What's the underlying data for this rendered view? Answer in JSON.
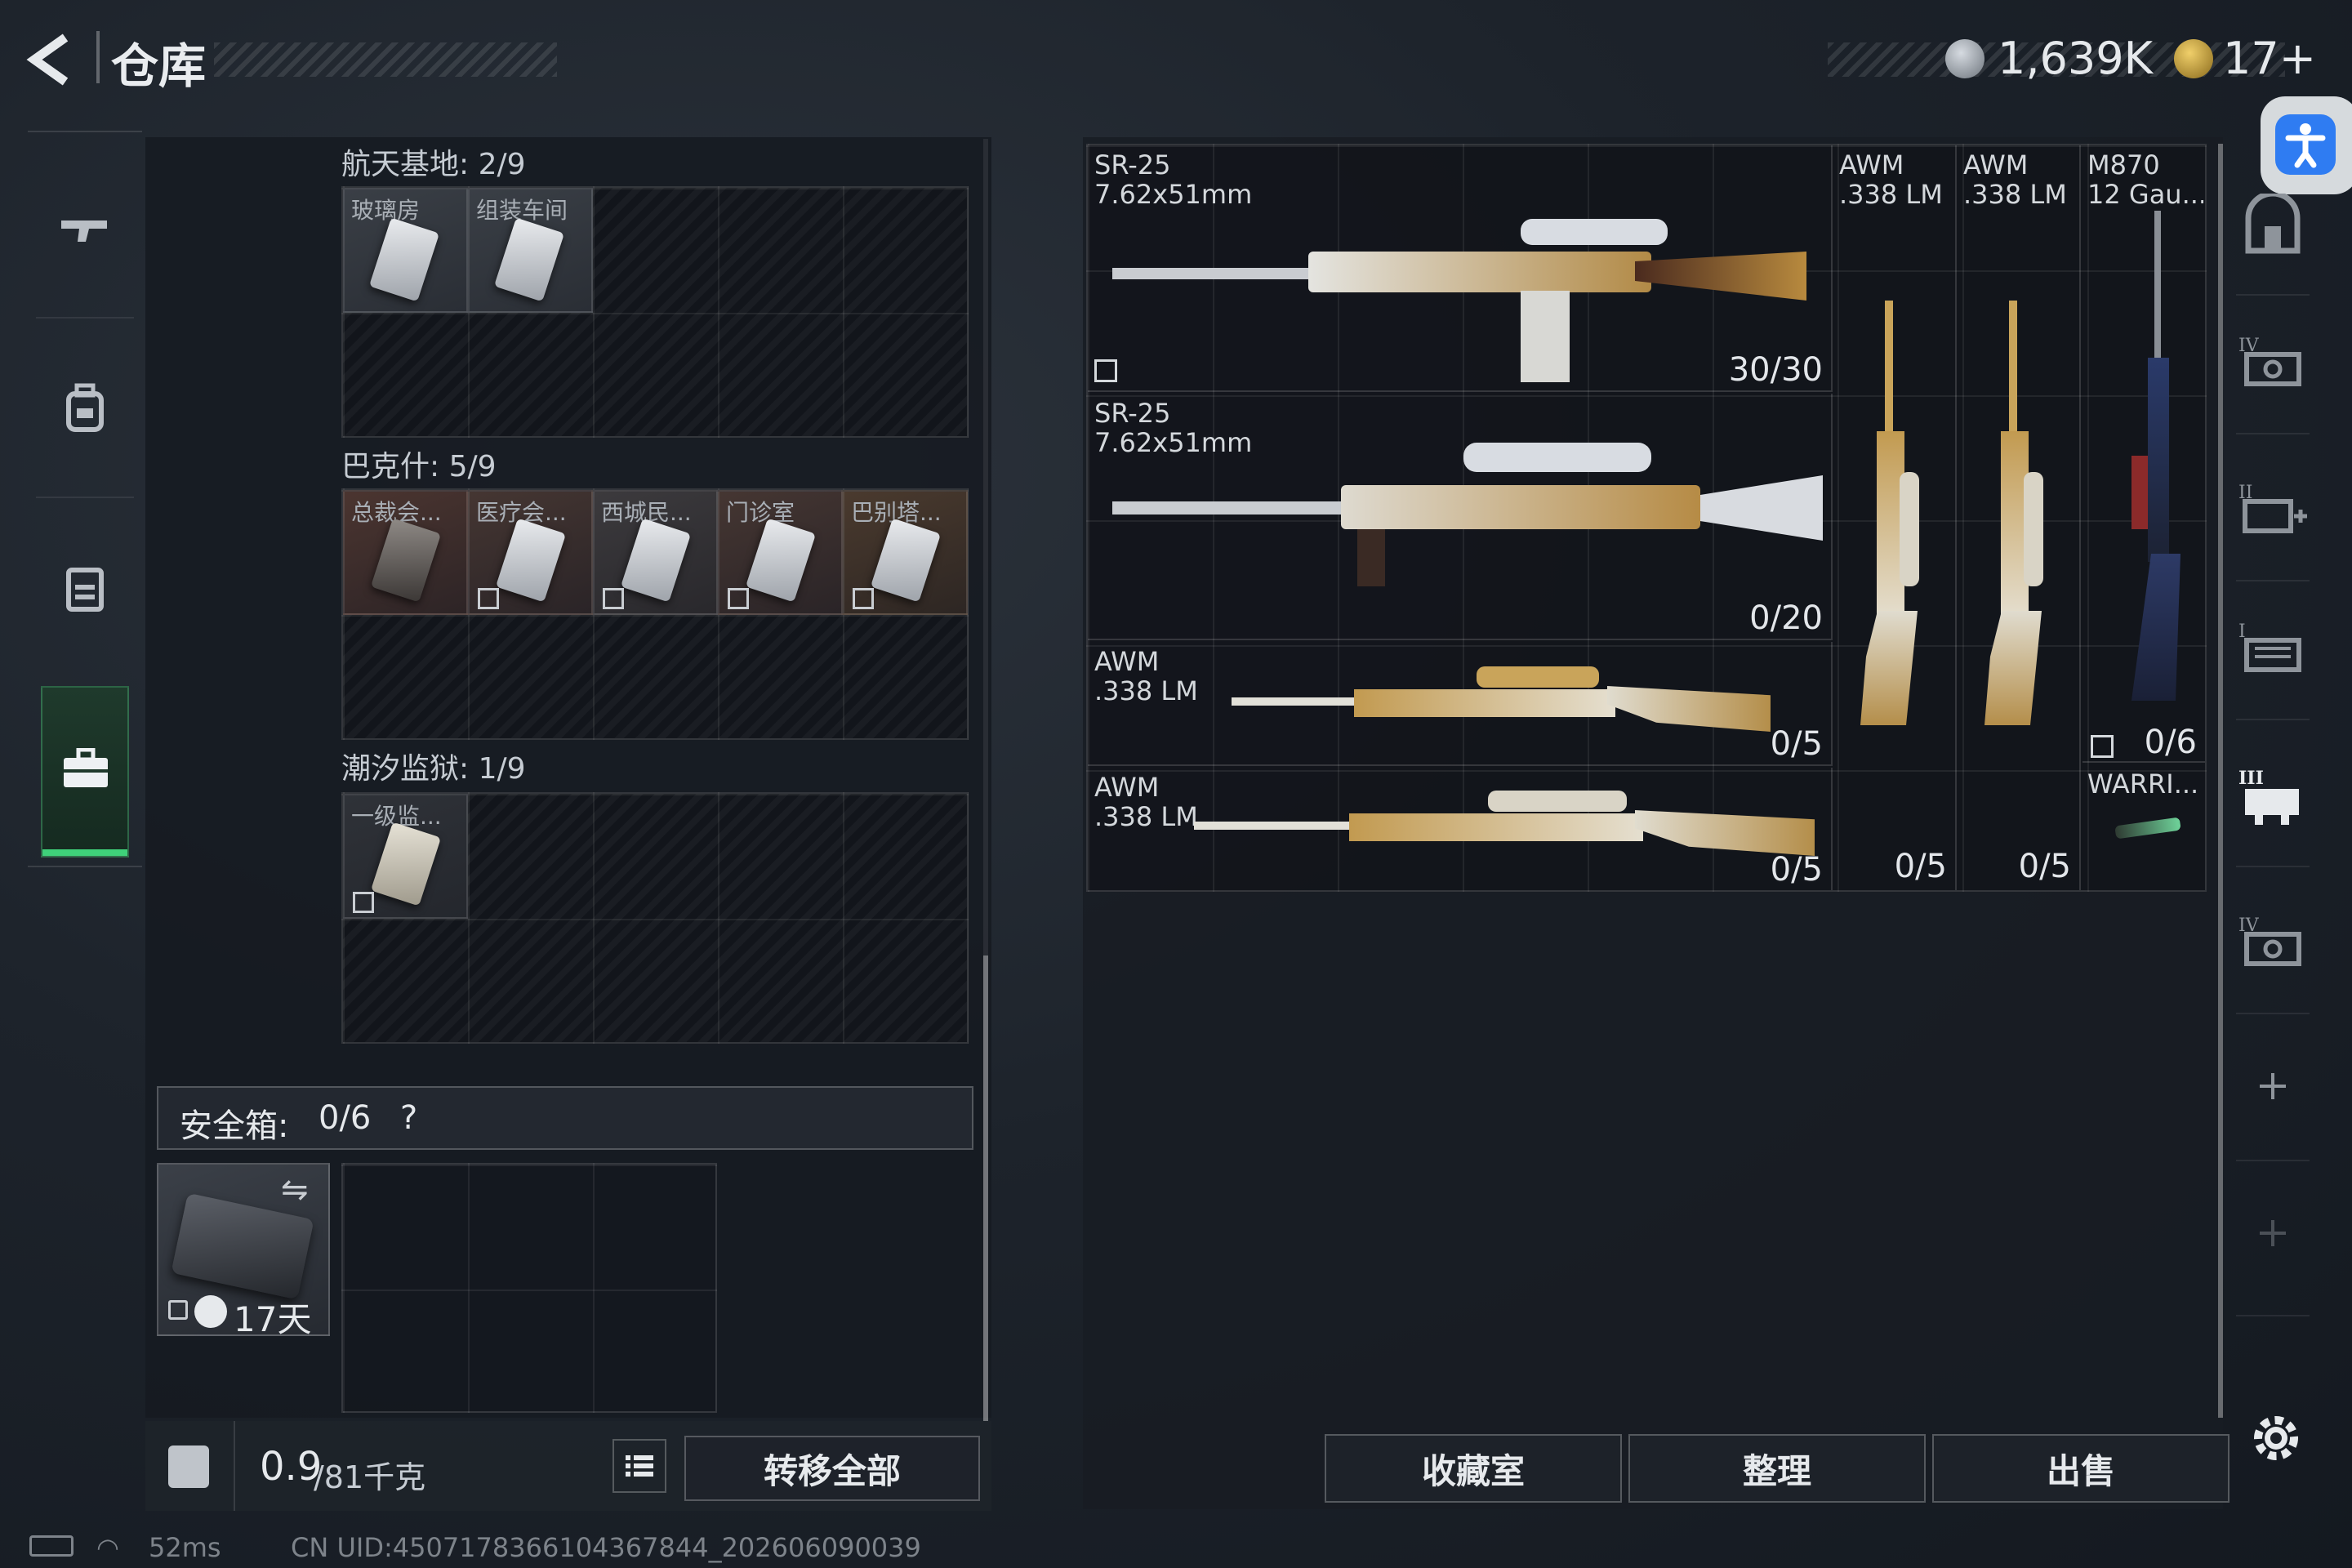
{
  "header": {
    "back_glyph": "<",
    "title": "仓库",
    "currency_amount": "1,639K",
    "ticket_amount": "17+"
  },
  "left_nav": {
    "items": [
      {
        "icon": "rifle-icon"
      },
      {
        "icon": "backpack-icon"
      },
      {
        "icon": "vest-icon"
      },
      {
        "icon": "briefcase-icon",
        "active": true
      }
    ],
    "accent_color": "#3fd17a"
  },
  "storage": {
    "sections": [
      {
        "title": "航天基地: 2/9",
        "items": [
          "玻璃房",
          "组装车间"
        ]
      },
      {
        "title": "巴克什: 5/9",
        "items": [
          "总裁会...",
          "医疗会...",
          "西城民...",
          "门诊室",
          "巴别塔..."
        ]
      },
      {
        "title": "潮汐监狱: 1/9",
        "items": [
          "一级监..."
        ]
      }
    ],
    "safe_box": {
      "label": "安全箱:",
      "count": "0/6",
      "help": "?",
      "timer": "17天"
    }
  },
  "footer": {
    "weight_value": "0.9",
    "weight_unit": "/81千克",
    "transfer_all": "转移全部"
  },
  "weapons": [
    {
      "name": "SR-25",
      "caliber": "7.62x51mm",
      "ammo": "30/30"
    },
    {
      "name": "SR-25",
      "caliber": "7.62x51mm",
      "ammo": "0/20"
    },
    {
      "name": "AWM",
      "caliber": ".338 LM",
      "ammo": "0/5"
    },
    {
      "name": "AWM",
      "caliber": ".338 LM",
      "ammo": "0/5"
    },
    {
      "name": "AWM",
      "caliber": ".338 LM",
      "ammo": "0/5"
    },
    {
      "name": "AWM",
      "caliber": ".338 LM",
      "ammo": "0/5"
    },
    {
      "name": "M870",
      "caliber": "12 Gau...",
      "ammo": "0/6"
    },
    {
      "name": "WARRI...",
      "caliber": "",
      "ammo": ""
    }
  ],
  "actions": {
    "collection": "收藏室",
    "sort": "整理",
    "sell": "出售"
  },
  "status_bar": {
    "ping": "52ms",
    "uid": "CN UID:4507178366104367844_202606090039"
  },
  "right_nav": {
    "items": [
      "vault-icon",
      "storage-iv-icon",
      "storage-ii-add-icon",
      "storage-i-icon",
      "storage-iii-icon",
      "storage-iv-b-icon",
      "add-icon",
      "add-icon-disabled"
    ]
  }
}
